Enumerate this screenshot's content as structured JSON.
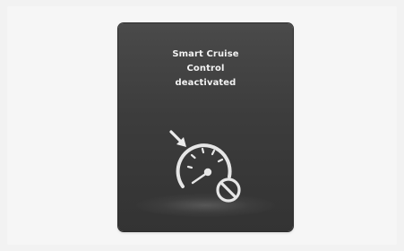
{
  "cluster_message": {
    "line1": "Smart Cruise",
    "line2": "Control",
    "line3": "deactivated"
  },
  "icons": {
    "status": "smart-cruise-control-deactivated-icon",
    "speedometer": "speedometer-icon",
    "arrow": "set-speed-arrow-icon",
    "prohibition": "no-symbol-icon"
  },
  "colors": {
    "display_bg": "#3c3c3c",
    "text": "#f2f2f2",
    "icon": "#e6e6e6"
  }
}
